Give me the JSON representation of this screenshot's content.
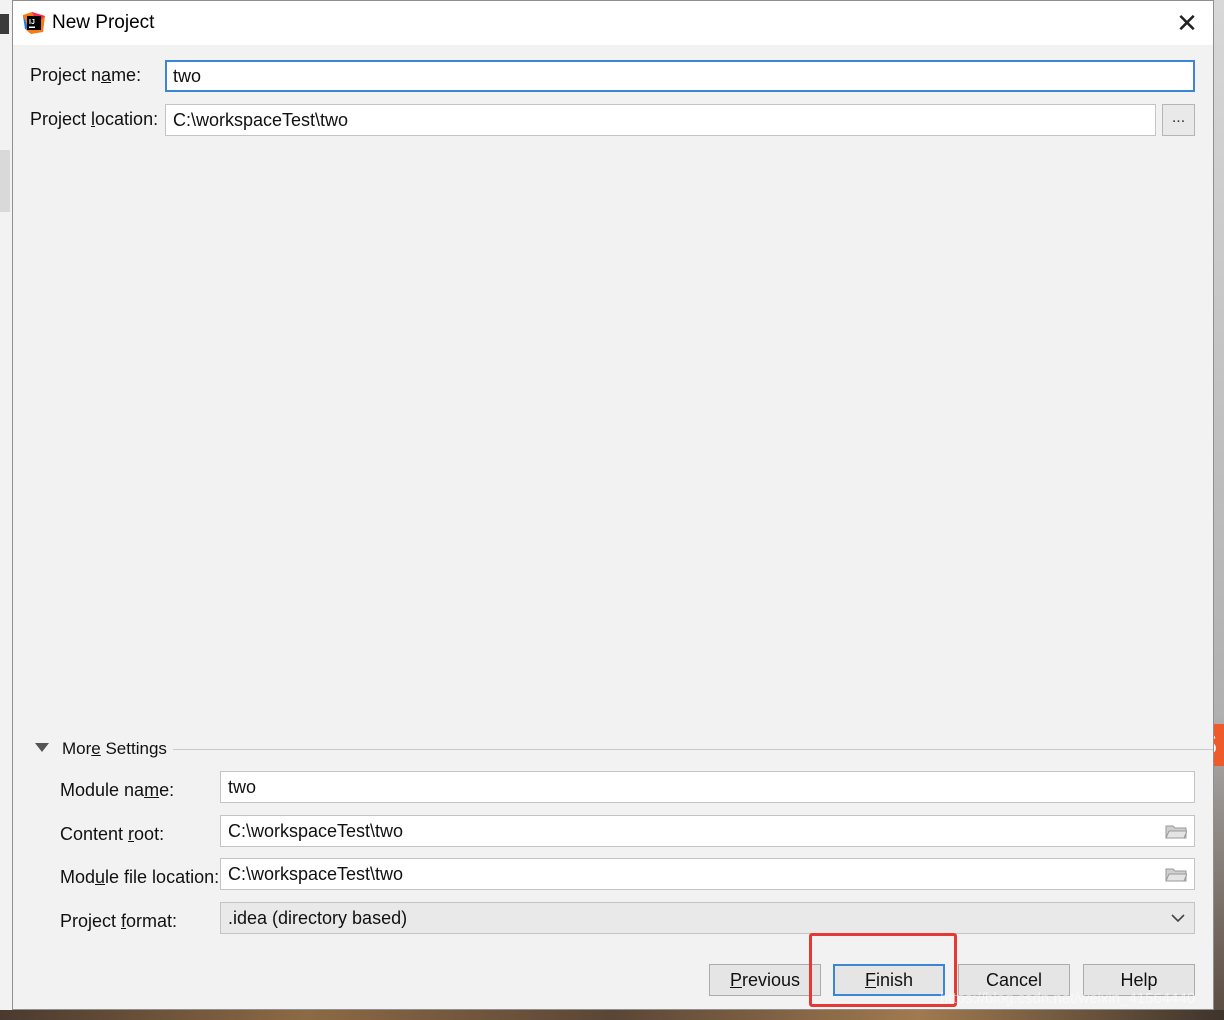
{
  "window": {
    "title": "New Project",
    "close_label": "✕",
    "app_icon_text": "IJ"
  },
  "fields": {
    "project_name": {
      "label_pre": "Project n",
      "label_ul": "a",
      "label_post": "me:",
      "value": "two"
    },
    "project_location": {
      "label_pre": "Project ",
      "label_ul": "l",
      "label_post": "ocation:",
      "value": "C:\\workspaceTest\\two",
      "browse_label": "..."
    }
  },
  "more_settings": {
    "label_pre": "Mor",
    "label_ul": "e",
    "label_post": " Settings",
    "module_name": {
      "label_pre": "Module na",
      "label_ul": "m",
      "label_post": "e:",
      "value": "two"
    },
    "content_root": {
      "label_pre": "Content ",
      "label_ul": "r",
      "label_post": "oot:",
      "value": "C:\\workspaceTest\\two"
    },
    "module_file_location": {
      "label_pre": "Mod",
      "label_ul": "u",
      "label_post": "le file location:",
      "value": "C:\\workspaceTest\\two"
    },
    "project_format": {
      "label_pre": "Project ",
      "label_ul": "f",
      "label_post": "ormat:",
      "value": ".idea (directory based)"
    }
  },
  "buttons": {
    "previous": {
      "ul": "P",
      "rest": "revious"
    },
    "finish": {
      "ul": "F",
      "rest": "inish"
    },
    "cancel": "Cancel",
    "help": "Help"
  },
  "overlay": {
    "sogou_letter": "S",
    "watermark": "https://blog.csdn.net/weixin_41564440"
  },
  "colors": {
    "focus": "#3d86d6",
    "highlight": "#e53935",
    "dialog_bg": "#f2f2f2"
  }
}
